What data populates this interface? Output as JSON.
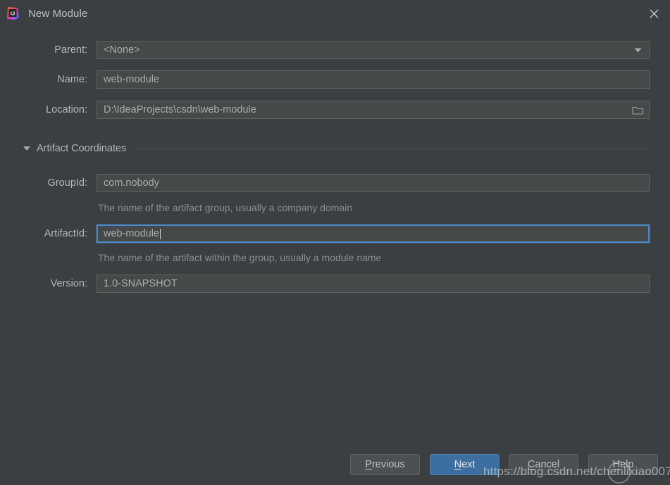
{
  "window": {
    "title": "New Module",
    "app_icon": "intellij-idea-logo",
    "close_icon": "close-icon"
  },
  "form": {
    "parent": {
      "label": "Parent:",
      "value": "<None>",
      "icon": "chevron-down-icon"
    },
    "name": {
      "label": "Name:",
      "value": "web-module"
    },
    "location": {
      "label": "Location:",
      "value": "D:\\IdeaProjects\\csdn\\web-module",
      "icon": "folder-icon"
    }
  },
  "section": {
    "label": "Artifact Coordinates",
    "icon": "triangle-down-icon",
    "expanded": true
  },
  "artifact": {
    "group_id": {
      "label": "GroupId:",
      "value": "com.nobody",
      "hint": "The name of the artifact group, usually a company domain"
    },
    "artifact_id": {
      "label": "ArtifactId:",
      "value": "web-module",
      "hint": "The name of the artifact within the group, usually a module name",
      "focused": true
    },
    "version": {
      "label": "Version:",
      "value": "1.0-SNAPSHOT"
    }
  },
  "footer": {
    "previous": {
      "label": "Previous",
      "mnemonic": "P"
    },
    "next": {
      "label": "Next",
      "mnemonic": "N"
    },
    "cancel": {
      "label": "Cancel",
      "mnemonic": "C"
    },
    "help": {
      "label": "Help",
      "mnemonic": "H"
    }
  },
  "watermark": {
    "text": "https://blog.csdn.net/chenlixiao007"
  },
  "colors": {
    "background": "#3C3F41",
    "field_background": "#45494A",
    "field_border": "#5E6364",
    "focus_border": "#4B88C7",
    "primary_button": "#3C6E9F",
    "text": "#BBBBBB",
    "hint_text": "#8B8D8F"
  }
}
